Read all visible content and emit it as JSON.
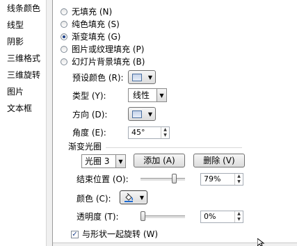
{
  "sidebar": {
    "items": [
      "线条颜色",
      "线型",
      "阴影",
      "三维格式",
      "三维旋转",
      "图片",
      "文本框"
    ]
  },
  "fill_options": {
    "no_fill": "无填充 (N)",
    "solid_fill": "纯色填充 (S)",
    "gradient_fill": "渐变填充 (G)",
    "picture_fill": "图片或纹理填充 (P)",
    "slide_bg_fill": "幻灯片背景填充 (B)",
    "selected": "gradient_fill"
  },
  "preset_colors": {
    "label": "预设颜色 (R):"
  },
  "type": {
    "label": "类型 (Y):",
    "value": "线性"
  },
  "direction": {
    "label": "方向 (D):"
  },
  "angle": {
    "label": "角度 (E):",
    "value": "45°"
  },
  "gradient_stops": {
    "heading": "渐变光圈",
    "stop_select": "光圈 3",
    "add_button": "添加 (A)",
    "delete_button": "删除 (V)",
    "end_position_label": "结束位置 (O):",
    "end_position_value": "79%",
    "end_position_level": 0.79,
    "color_label": "颜色 (C):",
    "transparency_label": "透明度 (T):",
    "transparency_value": "0%",
    "transparency_level": 0.0
  },
  "rotate_with_shape": {
    "label": "与形状一起旋转 (W)",
    "checked": true
  },
  "icons": {
    "color_button": "paint-bucket-icon",
    "cursor": "mouse-cursor-icon"
  },
  "colors": {
    "radio_dot": "#1b3f8a",
    "swatch": "#c6d4ea"
  }
}
